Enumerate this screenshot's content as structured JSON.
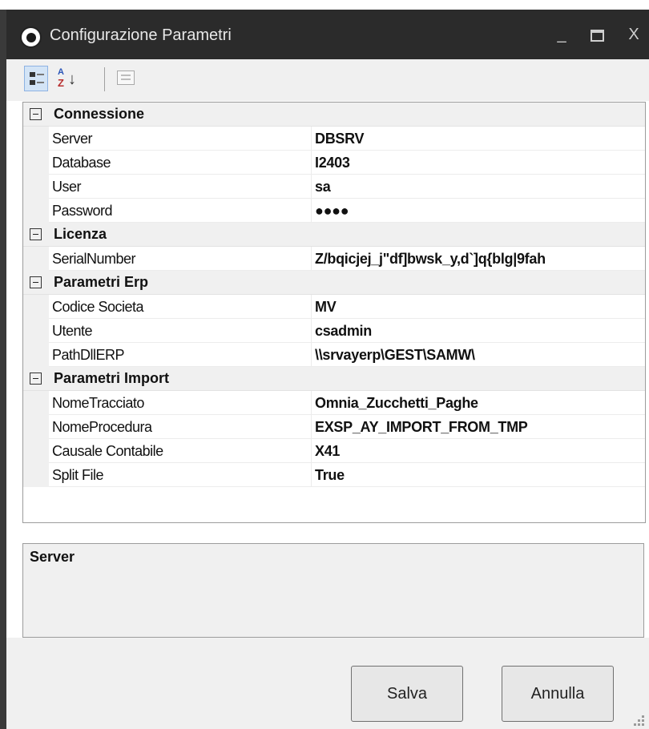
{
  "window": {
    "title": "Configurazione Parametri",
    "controls": {
      "minimize": "_",
      "close": "X"
    }
  },
  "toolbar": {
    "buttons": [
      {
        "name": "categorized",
        "icon": "categorized-icon",
        "active": true
      },
      {
        "name": "alphabetical",
        "icon": "sort-alphabetical-icon",
        "label_a": "A",
        "label_z": "Z",
        "arrow": "↓"
      },
      {
        "name": "property-pages",
        "icon": "property-pages-icon",
        "enabled": false
      }
    ]
  },
  "categories": [
    {
      "label": "Connessione",
      "properties": [
        {
          "name": "Server",
          "value": "DBSRV"
        },
        {
          "name": "Database",
          "value": "I2403"
        },
        {
          "name": "User",
          "value": "sa"
        },
        {
          "name": "Password",
          "value": "●●●●"
        }
      ]
    },
    {
      "label": "Licenza",
      "properties": [
        {
          "name": "SerialNumber",
          "value": "Z/bqicjej_j\"df]bwsk_y,d`]q{blg|9fah"
        }
      ]
    },
    {
      "label": "Parametri Erp",
      "properties": [
        {
          "name": "Codice Societa",
          "value": "MV"
        },
        {
          "name": "Utente",
          "value": "csadmin"
        },
        {
          "name": "PathDllERP",
          "value": "\\\\srvayerp\\GEST\\SAMW\\"
        }
      ]
    },
    {
      "label": "Parametri Import",
      "properties": [
        {
          "name": "NomeTracciato",
          "value": "Omnia_Zucchetti_Paghe"
        },
        {
          "name": "NomeProcedura",
          "value": "EXSP_AY_IMPORT_FROM_TMP"
        },
        {
          "name": "Causale Contabile",
          "value": "X41"
        },
        {
          "name": "Split File",
          "value": "True"
        }
      ]
    }
  ],
  "help": {
    "title": "Server"
  },
  "buttons": {
    "save": "Salva",
    "cancel": "Annulla"
  },
  "colors": {
    "titlebar": "#2b2b2b",
    "toolbar": "#f0f0f0",
    "category_row": "#f0f0f0",
    "active_button": "#d3e4f6"
  }
}
